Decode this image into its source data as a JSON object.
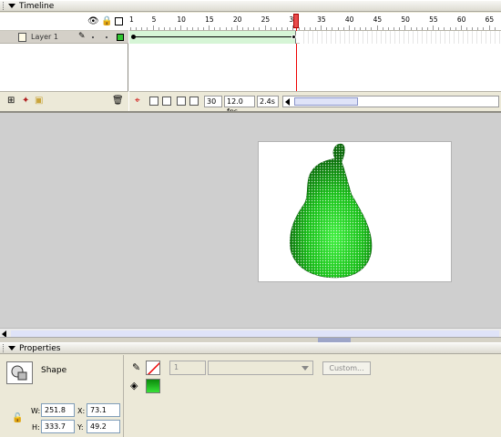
{
  "timeline": {
    "title": "Timeline",
    "layer": {
      "name": "Layer 1"
    },
    "frame_ruler": [
      "1",
      "5",
      "10",
      "15",
      "20",
      "25",
      "30",
      "35",
      "40",
      "45",
      "50",
      "55",
      "60",
      "65"
    ],
    "current_frame": "30",
    "frame_rate": "12.0 fps",
    "elapsed_time": "2.4s"
  },
  "properties": {
    "title": "Properties",
    "selection_type": "Shape",
    "width_label": "W:",
    "width": "251.8",
    "height_label": "H:",
    "height": "333.7",
    "x_label": "X:",
    "x": "73.1",
    "y_label": "Y:",
    "y": "49.2",
    "stroke_height": "1",
    "custom_button": "Custom..."
  },
  "colors": {
    "layer_color": "#31c431",
    "fill_color": "#16b516",
    "stage_bg": "#cfcfcf",
    "playhead": "#e84b4b"
  }
}
